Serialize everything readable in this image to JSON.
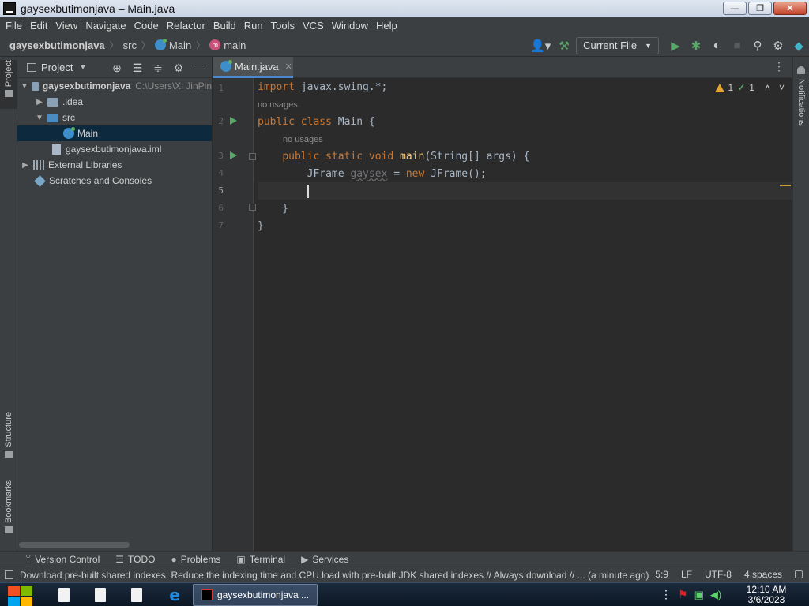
{
  "window": {
    "title": "gaysexbutimonjava – Main.java",
    "controls": [
      "0",
      "1",
      "r"
    ]
  },
  "menu": [
    {
      "label": "File"
    },
    {
      "label": "Edit"
    },
    {
      "label": "View"
    },
    {
      "label": "Navigate"
    },
    {
      "label": "Code"
    },
    {
      "label": "Refactor"
    },
    {
      "label": "Build"
    },
    {
      "label": "Run"
    },
    {
      "label": "Tools"
    },
    {
      "label": "VCS"
    },
    {
      "label": "Window"
    },
    {
      "label": "Help"
    }
  ],
  "breadcrumb": {
    "project": "gaysexbutimonjava",
    "folder": "src",
    "class": "Main",
    "method": "main"
  },
  "toolbar": {
    "run_config": "Current File"
  },
  "project_panel": {
    "title": "Project",
    "tree": [
      {
        "label": "gaysexbutimonjava",
        "path": "C:\\Users\\Xi JinPin"
      },
      {
        "label": ".idea"
      },
      {
        "label": "src"
      },
      {
        "label": "Main"
      },
      {
        "label": "gaysexbutimonjava.iml"
      },
      {
        "label": "External Libraries"
      },
      {
        "label": "Scratches and Consoles"
      }
    ]
  },
  "left_strip": {
    "project": "Project",
    "structure": "Structure",
    "bookmarks": "Bookmarks"
  },
  "right_strip": {
    "notifications": "Notifications"
  },
  "editor": {
    "tab": "Main.java",
    "warnings": "1",
    "weak_warnings": "1",
    "line_numbers": [
      "1",
      "2",
      "3",
      "4",
      "5",
      "6",
      "7"
    ],
    "hints": [
      "no usages",
      "no usages"
    ],
    "code": {
      "l1_kw": "import",
      "l1_rest": " javax.swing.*;",
      "l2_kw": "public class",
      "l2_rest": " Main {",
      "l3_indent": "    ",
      "l3_kw": "public static void",
      "l3_space": " ",
      "l3_fn": "main",
      "l3_rest": "(String[] args) {",
      "l4_a": "        JFrame ",
      "l4_var": "gaysex",
      "l4_b": " = ",
      "l4_kw": "new",
      "l4_c": " JFrame();",
      "l6": "    }",
      "l7": "}"
    }
  },
  "tool_windows": [
    {
      "label": "Version Control"
    },
    {
      "label": "TODO"
    },
    {
      "label": "Problems"
    },
    {
      "label": "Terminal"
    },
    {
      "label": "Services"
    }
  ],
  "status": {
    "message": "Download pre-built shared indexes: Reduce the indexing time and CPU load with pre-built JDK shared indexes // Always download // ... (a minute ago)",
    "position": "5:9",
    "line_sep": "LF",
    "encoding": "UTF-8",
    "indent": "4 spaces"
  },
  "taskbar": {
    "app_label": "gaysexbutimonjava ...",
    "time": "12:10 AM",
    "date": "3/6/2023"
  },
  "colors": {
    "keyword": "#cc7832",
    "function": "#ffc66d",
    "run_green": "#59a869",
    "selection": "#0d293e",
    "tab_underline": "#4a88c7"
  }
}
